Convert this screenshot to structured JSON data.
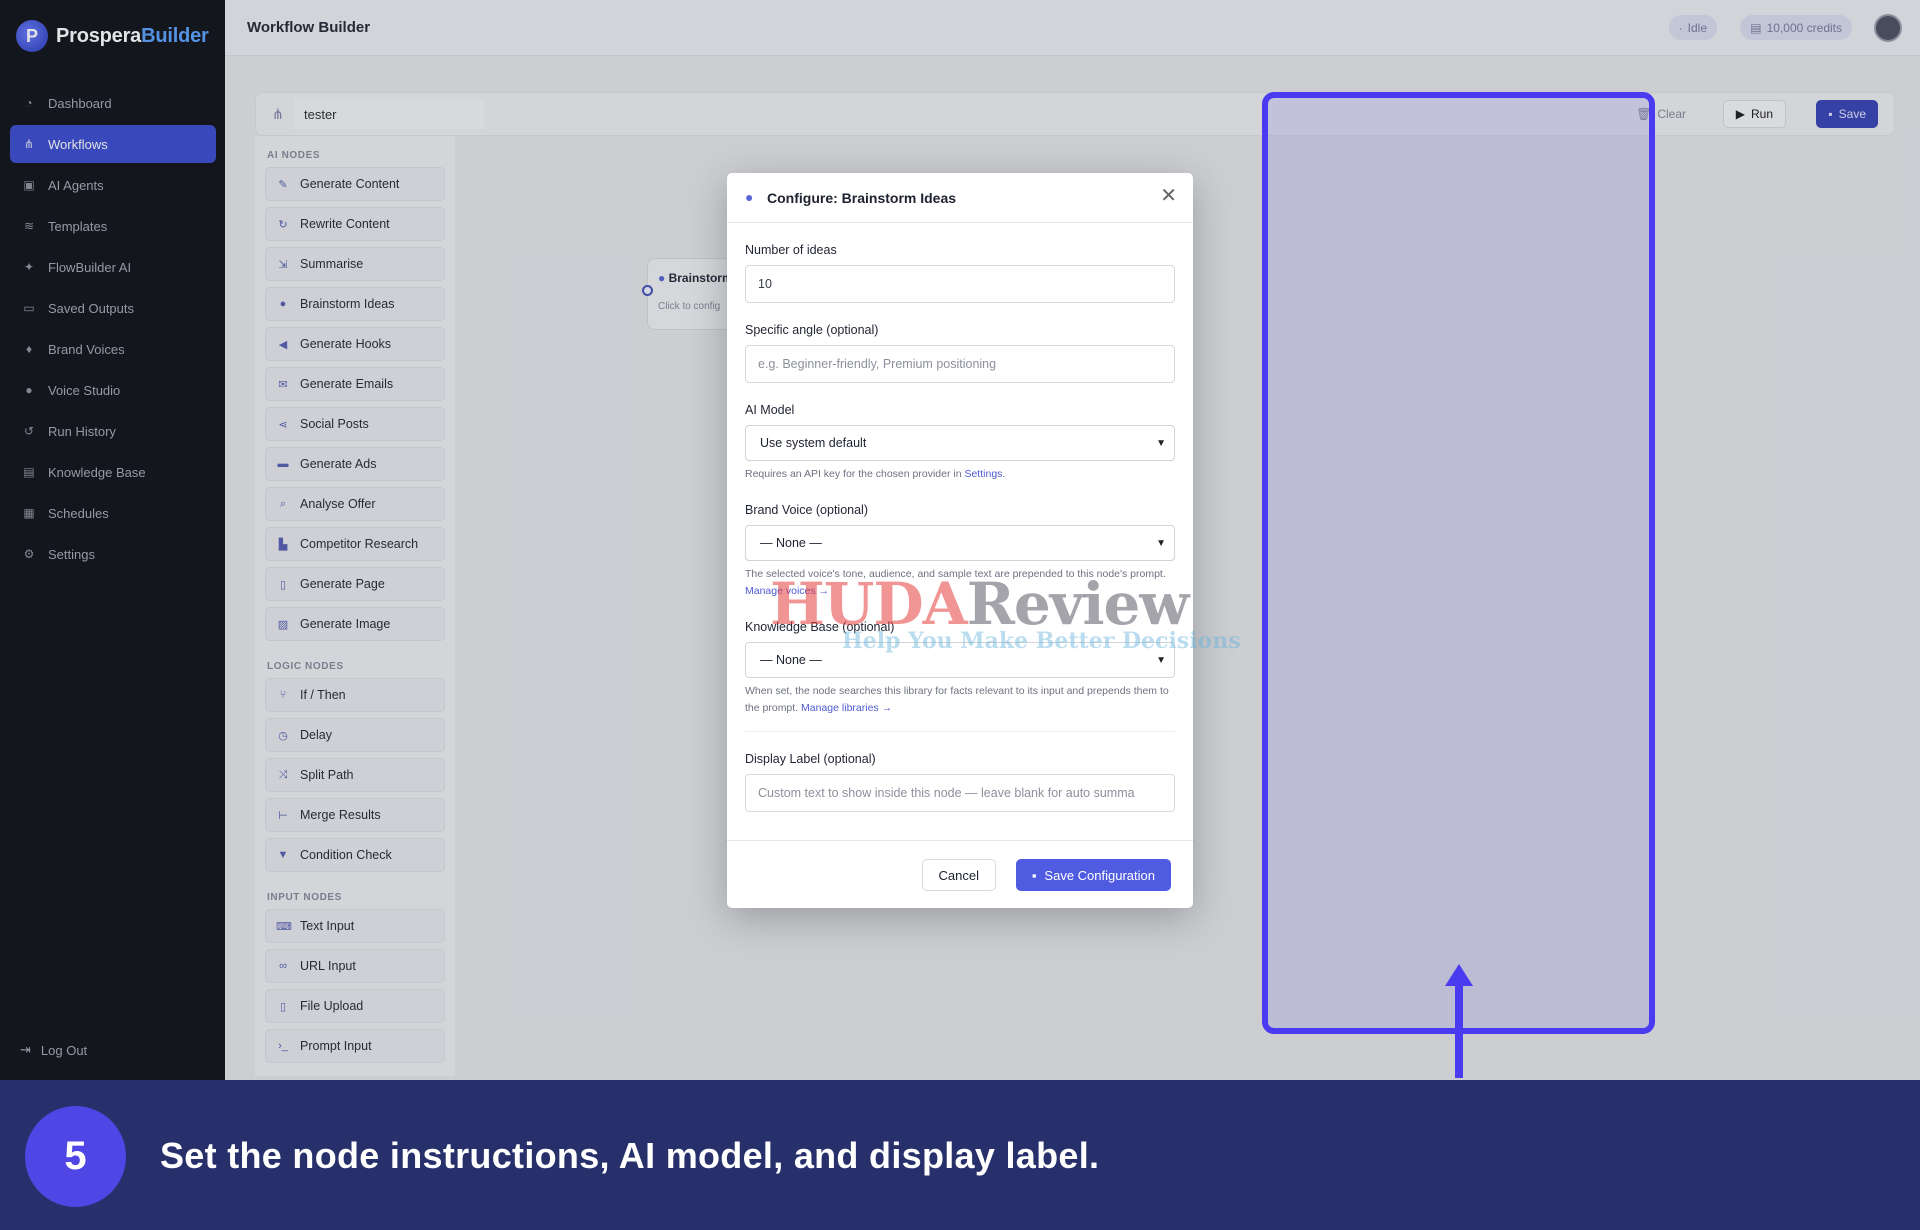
{
  "app": {
    "logo_part1": "Prospera",
    "logo_part2": "Builder"
  },
  "sidebar": {
    "items": [
      {
        "label": "Dashboard",
        "icon": "dashboard-icon"
      },
      {
        "label": "Workflows",
        "icon": "workflow-icon",
        "active": true
      },
      {
        "label": "AI Agents",
        "icon": "robot-icon"
      },
      {
        "label": "Templates",
        "icon": "layers-icon"
      },
      {
        "label": "FlowBuilder AI",
        "icon": "wand-icon"
      },
      {
        "label": "Saved Outputs",
        "icon": "inbox-icon"
      },
      {
        "label": "Brand Voices",
        "icon": "microphone-icon"
      },
      {
        "label": "Voice Studio",
        "icon": "mic-icon"
      },
      {
        "label": "Run History",
        "icon": "history-icon"
      },
      {
        "label": "Knowledge Base",
        "icon": "book-icon"
      },
      {
        "label": "Schedules",
        "icon": "calendar-icon"
      },
      {
        "label": "Settings",
        "icon": "gear-icon"
      }
    ],
    "logout": "Log Out"
  },
  "header": {
    "title": "Workflow Builder",
    "status": "Idle",
    "credits": "10,000 credits"
  },
  "toolbar": {
    "workflow_name": "tester",
    "clear": "Clear",
    "run": "Run",
    "save": "Save"
  },
  "panel": {
    "ai_heading": "AI NODES",
    "ai_nodes": [
      "Generate Content",
      "Rewrite Content",
      "Summarise",
      "Brainstorm Ideas",
      "Generate Hooks",
      "Generate Emails",
      "Social Posts",
      "Generate Ads",
      "Analyse Offer",
      "Competitor Research",
      "Generate Page",
      "Generate Image"
    ],
    "logic_heading": "LOGIC NODES",
    "logic_nodes": [
      "If / Then",
      "Delay",
      "Split Path",
      "Merge Results",
      "Condition Check"
    ],
    "input_heading": "INPUT NODES",
    "input_nodes": [
      "Text Input",
      "URL Input",
      "File Upload",
      "Prompt Input"
    ]
  },
  "canvas_node": {
    "title": "Brainstorm",
    "subtitle": "Click to config"
  },
  "modal": {
    "title": "Configure: Brainstorm Ideas",
    "ideas_label": "Number of ideas",
    "ideas_value": "10",
    "angle_label": "Specific angle (optional)",
    "angle_placeholder": "e.g. Beginner-friendly, Premium positioning",
    "model_label": "AI Model",
    "model_value": "Use system default",
    "model_help": "Requires an API key for the chosen provider in",
    "model_help_link": "Settings",
    "voice_label": "Brand Voice (optional)",
    "voice_value": "— None —",
    "voice_help": "The selected voice's tone, audience, and sample text are prepended to this node's prompt.",
    "voice_help_link": "Manage voices →",
    "kb_label": "Knowledge Base (optional)",
    "kb_value": "— None —",
    "kb_help": "When set, the node searches this library for facts relevant to its input and prepends them to the prompt.",
    "kb_help_link": "Manage libraries →",
    "display_label": "Display Label (optional)",
    "display_placeholder": "Custom text to show inside this node — leave blank for auto summa",
    "cancel": "Cancel",
    "save": "Save Configuration"
  },
  "watermark": {
    "part1": "HUDA",
    "part2": "Review",
    "tagline": "Help You Make Better Decisions"
  },
  "caption": {
    "step": "5",
    "text": "Set the node instructions, AI model, and display label."
  },
  "colors": {
    "accent": "#4f5be0",
    "sidebar_bg": "#15161d",
    "caption_bg": "#27306b",
    "highlight": "#4a3bf0"
  }
}
